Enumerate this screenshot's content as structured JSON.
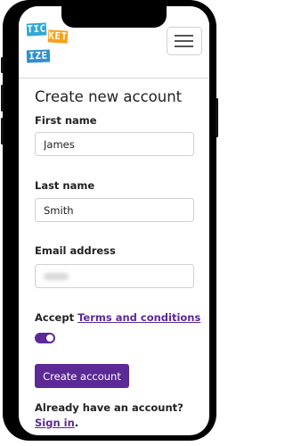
{
  "brand": {
    "logo_rows": [
      {
        "tiles": [
          {
            "text": "TIC",
            "color": "#2fa8d8"
          },
          {
            "text": "KET",
            "color": "#f4a21b"
          }
        ]
      },
      {
        "tiles": [
          {
            "text": "IZE",
            "color": "#2d8fd0"
          }
        ]
      }
    ],
    "accent": "#5b2a96"
  },
  "header": {
    "menu_icon": "hamburger-icon"
  },
  "form": {
    "title": "Create new account",
    "first_name": {
      "label": "First name",
      "value": "James"
    },
    "last_name": {
      "label": "Last name",
      "value": "Smith"
    },
    "email": {
      "label": "Email address",
      "value": ""
    },
    "terms": {
      "prefix": "Accept ",
      "link": "Terms and conditions",
      "toggle_on": true
    },
    "submit_label": "Create account",
    "signin": {
      "prompt": "Already have an account?",
      "link": "Sign in",
      "suffix": "."
    }
  }
}
